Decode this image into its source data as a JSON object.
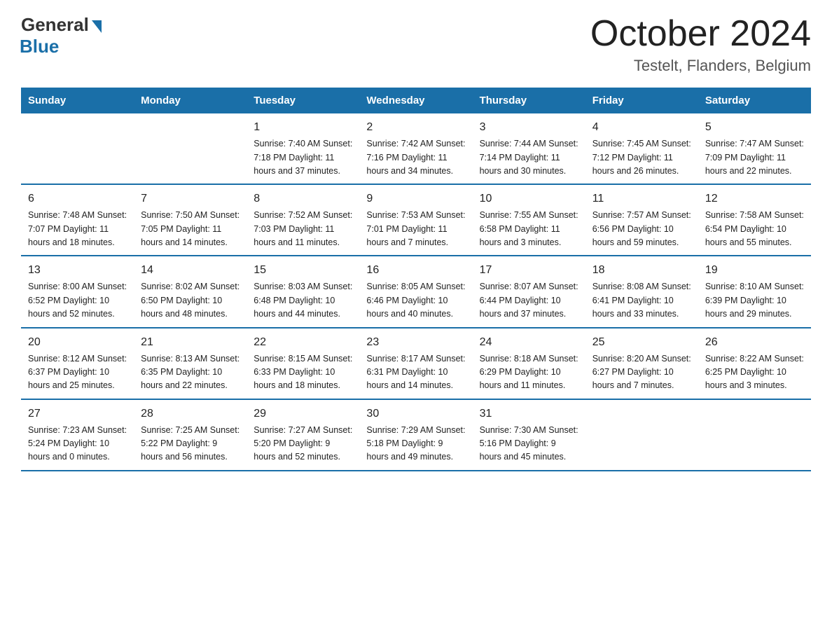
{
  "header": {
    "logo_general": "General",
    "logo_blue": "Blue",
    "title": "October 2024",
    "location": "Testelt, Flanders, Belgium"
  },
  "days_of_week": [
    "Sunday",
    "Monday",
    "Tuesday",
    "Wednesday",
    "Thursday",
    "Friday",
    "Saturday"
  ],
  "weeks": [
    [
      {
        "day": "",
        "info": ""
      },
      {
        "day": "",
        "info": ""
      },
      {
        "day": "1",
        "info": "Sunrise: 7:40 AM\nSunset: 7:18 PM\nDaylight: 11 hours\nand 37 minutes."
      },
      {
        "day": "2",
        "info": "Sunrise: 7:42 AM\nSunset: 7:16 PM\nDaylight: 11 hours\nand 34 minutes."
      },
      {
        "day": "3",
        "info": "Sunrise: 7:44 AM\nSunset: 7:14 PM\nDaylight: 11 hours\nand 30 minutes."
      },
      {
        "day": "4",
        "info": "Sunrise: 7:45 AM\nSunset: 7:12 PM\nDaylight: 11 hours\nand 26 minutes."
      },
      {
        "day": "5",
        "info": "Sunrise: 7:47 AM\nSunset: 7:09 PM\nDaylight: 11 hours\nand 22 minutes."
      }
    ],
    [
      {
        "day": "6",
        "info": "Sunrise: 7:48 AM\nSunset: 7:07 PM\nDaylight: 11 hours\nand 18 minutes."
      },
      {
        "day": "7",
        "info": "Sunrise: 7:50 AM\nSunset: 7:05 PM\nDaylight: 11 hours\nand 14 minutes."
      },
      {
        "day": "8",
        "info": "Sunrise: 7:52 AM\nSunset: 7:03 PM\nDaylight: 11 hours\nand 11 minutes."
      },
      {
        "day": "9",
        "info": "Sunrise: 7:53 AM\nSunset: 7:01 PM\nDaylight: 11 hours\nand 7 minutes."
      },
      {
        "day": "10",
        "info": "Sunrise: 7:55 AM\nSunset: 6:58 PM\nDaylight: 11 hours\nand 3 minutes."
      },
      {
        "day": "11",
        "info": "Sunrise: 7:57 AM\nSunset: 6:56 PM\nDaylight: 10 hours\nand 59 minutes."
      },
      {
        "day": "12",
        "info": "Sunrise: 7:58 AM\nSunset: 6:54 PM\nDaylight: 10 hours\nand 55 minutes."
      }
    ],
    [
      {
        "day": "13",
        "info": "Sunrise: 8:00 AM\nSunset: 6:52 PM\nDaylight: 10 hours\nand 52 minutes."
      },
      {
        "day": "14",
        "info": "Sunrise: 8:02 AM\nSunset: 6:50 PM\nDaylight: 10 hours\nand 48 minutes."
      },
      {
        "day": "15",
        "info": "Sunrise: 8:03 AM\nSunset: 6:48 PM\nDaylight: 10 hours\nand 44 minutes."
      },
      {
        "day": "16",
        "info": "Sunrise: 8:05 AM\nSunset: 6:46 PM\nDaylight: 10 hours\nand 40 minutes."
      },
      {
        "day": "17",
        "info": "Sunrise: 8:07 AM\nSunset: 6:44 PM\nDaylight: 10 hours\nand 37 minutes."
      },
      {
        "day": "18",
        "info": "Sunrise: 8:08 AM\nSunset: 6:41 PM\nDaylight: 10 hours\nand 33 minutes."
      },
      {
        "day": "19",
        "info": "Sunrise: 8:10 AM\nSunset: 6:39 PM\nDaylight: 10 hours\nand 29 minutes."
      }
    ],
    [
      {
        "day": "20",
        "info": "Sunrise: 8:12 AM\nSunset: 6:37 PM\nDaylight: 10 hours\nand 25 minutes."
      },
      {
        "day": "21",
        "info": "Sunrise: 8:13 AM\nSunset: 6:35 PM\nDaylight: 10 hours\nand 22 minutes."
      },
      {
        "day": "22",
        "info": "Sunrise: 8:15 AM\nSunset: 6:33 PM\nDaylight: 10 hours\nand 18 minutes."
      },
      {
        "day": "23",
        "info": "Sunrise: 8:17 AM\nSunset: 6:31 PM\nDaylight: 10 hours\nand 14 minutes."
      },
      {
        "day": "24",
        "info": "Sunrise: 8:18 AM\nSunset: 6:29 PM\nDaylight: 10 hours\nand 11 minutes."
      },
      {
        "day": "25",
        "info": "Sunrise: 8:20 AM\nSunset: 6:27 PM\nDaylight: 10 hours\nand 7 minutes."
      },
      {
        "day": "26",
        "info": "Sunrise: 8:22 AM\nSunset: 6:25 PM\nDaylight: 10 hours\nand 3 minutes."
      }
    ],
    [
      {
        "day": "27",
        "info": "Sunrise: 7:23 AM\nSunset: 5:24 PM\nDaylight: 10 hours\nand 0 minutes."
      },
      {
        "day": "28",
        "info": "Sunrise: 7:25 AM\nSunset: 5:22 PM\nDaylight: 9 hours\nand 56 minutes."
      },
      {
        "day": "29",
        "info": "Sunrise: 7:27 AM\nSunset: 5:20 PM\nDaylight: 9 hours\nand 52 minutes."
      },
      {
        "day": "30",
        "info": "Sunrise: 7:29 AM\nSunset: 5:18 PM\nDaylight: 9 hours\nand 49 minutes."
      },
      {
        "day": "31",
        "info": "Sunrise: 7:30 AM\nSunset: 5:16 PM\nDaylight: 9 hours\nand 45 minutes."
      },
      {
        "day": "",
        "info": ""
      },
      {
        "day": "",
        "info": ""
      }
    ]
  ]
}
